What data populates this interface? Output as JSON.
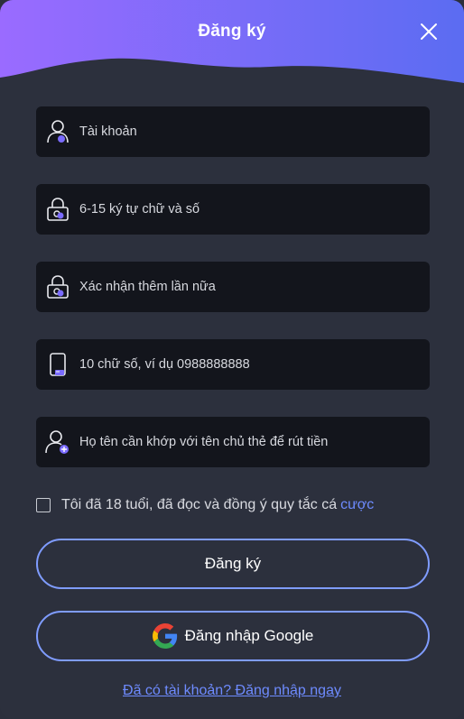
{
  "header": {
    "title": "Đăng ký",
    "gradient_start": "#9a6bff",
    "gradient_end": "#5b6cf2"
  },
  "form": {
    "username": {
      "placeholder": "Tài khoản",
      "value": "",
      "icon": "user-icon"
    },
    "password": {
      "placeholder": "6-15 ký tự chữ và số",
      "value": "",
      "icon": "lock-icon"
    },
    "confirm_password": {
      "placeholder": "Xác nhận thêm lần nữa",
      "value": "",
      "icon": "lock-icon"
    },
    "phone": {
      "placeholder": "10 chữ số, ví dụ 0988888888",
      "value": "",
      "icon": "phone-icon"
    },
    "full_name": {
      "placeholder": "Họ tên cần khớp với tên chủ thẻ để rút tiền",
      "value": "",
      "icon": "user-add-icon"
    }
  },
  "agreement": {
    "checked": false,
    "text": "Tôi đã 18 tuổi, đã đọc và đồng ý quy tắc cá",
    "link_text": "cược"
  },
  "buttons": {
    "register": "Đăng ký",
    "google_login": "Đăng nhập Google"
  },
  "footer": {
    "login_link": "Đã có tài khoản? Đăng nhập ngay"
  },
  "colors": {
    "accent": "#7f9cff",
    "link": "#6e8bff",
    "background": "#2c303d",
    "field_bg": "#13151c"
  }
}
